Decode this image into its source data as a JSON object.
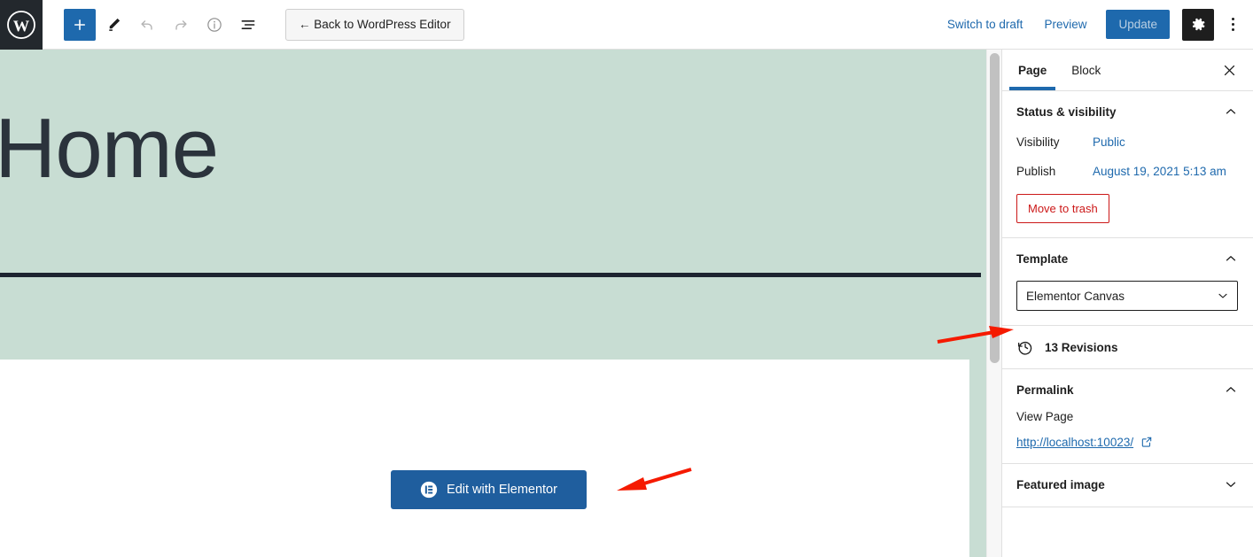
{
  "toolbar": {
    "wp_logo": "wordpress-logo",
    "add_block_label": "+",
    "tools_label": "Tools",
    "undo_label": "Undo",
    "redo_label": "Redo",
    "details_label": "Details",
    "list_view_label": "List view",
    "back_label": "← Back to WordPress Editor",
    "switch_to_draft": "Switch to draft",
    "preview": "Preview",
    "update": "Update",
    "settings_label": "Settings",
    "options_label": "Options"
  },
  "canvas": {
    "site_title": "Home",
    "elementor_button": "Edit with Elementor"
  },
  "sidebar": {
    "tabs": [
      {
        "label": "Page",
        "active": true
      },
      {
        "label": "Block",
        "active": false
      }
    ],
    "close_label": "Close settings",
    "status": {
      "title": "Status & visibility",
      "visibility_label": "Visibility",
      "visibility_value": "Public",
      "publish_label": "Publish",
      "publish_value": "August 19, 2021 5:13 am",
      "trash_label": "Move to trash"
    },
    "template": {
      "title": "Template",
      "selected": "Elementor Canvas"
    },
    "revisions": {
      "label": "13 Revisions"
    },
    "permalink": {
      "title": "Permalink",
      "view_label": "View Page",
      "url": "http://localhost:10023/"
    },
    "featured_image": {
      "title": "Featured image"
    }
  },
  "colors": {
    "accent_blue": "#1e69ad",
    "hero_green": "#c8ddd3",
    "danger_red": "#cc1818",
    "annotation_red": "#f51a00",
    "dark_bar": "#1d2430",
    "elementor_blue": "#1f5e9e"
  }
}
